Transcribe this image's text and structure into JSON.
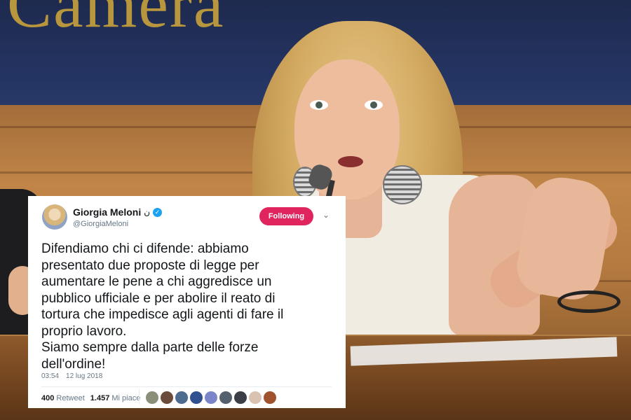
{
  "background": {
    "wall_text": "Camera",
    "colors": {
      "wall": "#243462",
      "wood": "#c08547",
      "lettering": "#b8963e"
    }
  },
  "tweet": {
    "author_name": "Giorgia Meloni",
    "author_glyph": "ن",
    "handle": "@GiorgiaMeloni",
    "follow_label": "Following",
    "follow_color": "#e0245e",
    "body_lines": [
      "Difendiamo chi ci difende: abbiamo",
      "presentato due proposte di legge per",
      "aumentare le pene a chi aggredisce un",
      "pubblico ufficiale e per abolire il reato di",
      "tortura che impedisce agli agenti di fare il",
      "proprio lavoro.",
      "Siamo sempre dalla parte delle forze",
      "dell'ordine!"
    ],
    "time": "03:54",
    "date": "12 lug 2018",
    "retweet_count": "400",
    "retweet_label": "Retweet",
    "like_count": "1.457",
    "like_label": "Mi piace",
    "liker_avatars": [
      {
        "name": "avatar-1",
        "color": "#8a8f7a"
      },
      {
        "name": "avatar-2",
        "color": "#6b4c3b"
      },
      {
        "name": "avatar-3",
        "color": "#4d6a8f"
      },
      {
        "name": "avatar-4",
        "color": "#2f4f8f"
      },
      {
        "name": "avatar-5",
        "color": "#7a86c9"
      },
      {
        "name": "avatar-6",
        "color": "#55606e"
      },
      {
        "name": "avatar-7",
        "color": "#3a3f47"
      },
      {
        "name": "avatar-8",
        "color": "#d9c3b0"
      },
      {
        "name": "avatar-9",
        "color": "#a0522d"
      }
    ]
  }
}
